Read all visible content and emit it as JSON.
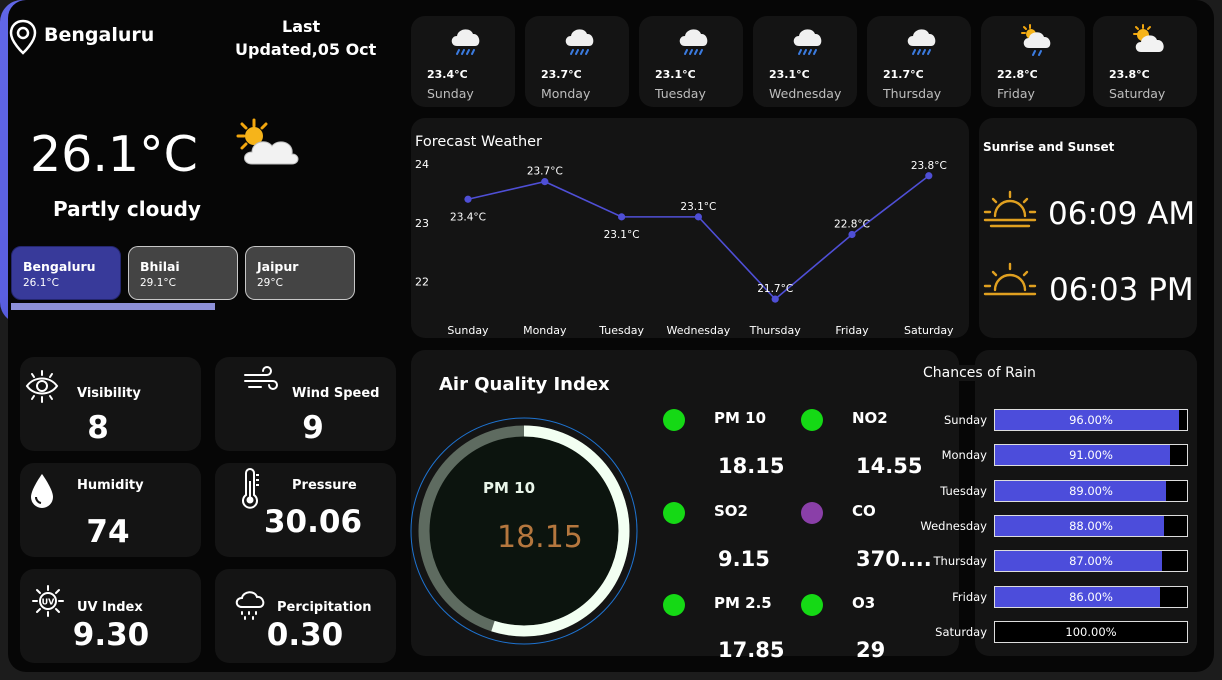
{
  "location": {
    "city": "Bengaluru",
    "last_updated_line1": "Last",
    "last_updated_line2": "Updated,05 Oct",
    "temperature": "26.1°C",
    "condition": "Partly cloudy",
    "icon": "partly-cloudy-icon",
    "cities": [
      {
        "name": "Bengaluru",
        "temp": "26.1°C"
      },
      {
        "name": "Bhilai",
        "temp": "29.1°C"
      },
      {
        "name": "Jaipur",
        "temp": "29°C"
      }
    ]
  },
  "week": [
    {
      "day": "Sunday",
      "temp": "23.4°C",
      "icon": "rain-cloud-icon"
    },
    {
      "day": "Monday",
      "temp": "23.7°C",
      "icon": "rain-cloud-icon"
    },
    {
      "day": "Tuesday",
      "temp": "23.1°C",
      "icon": "rain-cloud-icon"
    },
    {
      "day": "Wednesday",
      "temp": "23.1°C",
      "icon": "rain-cloud-icon"
    },
    {
      "day": "Thursday",
      "temp": "21.7°C",
      "icon": "rain-cloud-icon"
    },
    {
      "day": "Friday",
      "temp": "22.8°C",
      "icon": "sun-rain-cloud-icon"
    },
    {
      "day": "Saturday",
      "temp": "23.8°C",
      "icon": "partly-cloudy-icon"
    }
  ],
  "forecast": {
    "title": "Forecast Weather",
    "y_ticks": [
      "24",
      "23",
      "22"
    ]
  },
  "chart_data": {
    "type": "line",
    "title": "Forecast Weather",
    "categories": [
      "Sunday",
      "Monday",
      "Tuesday",
      "Wednesday",
      "Thursday",
      "Friday",
      "Saturday"
    ],
    "values": [
      23.4,
      23.7,
      23.1,
      23.1,
      21.7,
      22.8,
      23.8
    ],
    "labels": [
      "23.4°C",
      "23.7°C",
      "23.1°C",
      "23.1°C",
      "21.7°C",
      "22.8°C",
      "23.8°C"
    ],
    "ylim": [
      21.6,
      24
    ],
    "y_ticks": [
      22,
      23,
      24
    ],
    "line_color": "#4f4fd6",
    "grid": false
  },
  "sun": {
    "title": "Sunrise and Sunset",
    "sunrise": "06:09 AM",
    "sunset": "06:03 PM",
    "icon_color": "#e0a020"
  },
  "metrics": {
    "visibility": {
      "label": "Visibility",
      "value": "8",
      "icon": "eye-icon"
    },
    "wind": {
      "label": "Wind Speed",
      "value": "9",
      "icon": "wind-icon"
    },
    "humidity": {
      "label": "Humidity",
      "value": "74",
      "icon": "water-drop-icon"
    },
    "pressure": {
      "label": "Pressure",
      "value": "30.06",
      "icon": "thermometer-icon"
    },
    "uv": {
      "label": "UV Index",
      "value": "9.30",
      "icon": "uv-sun-icon"
    },
    "precip": {
      "label": "Percipitation",
      "value": "0.30",
      "icon": "rain-cloud-icon"
    }
  },
  "aqi": {
    "title": "Air Quality Index",
    "gauge_label": "PM 10",
    "gauge_value": "18.15",
    "gauge_fraction": 0.55,
    "items": [
      {
        "name": "PM 10",
        "value": "18.15",
        "color": "#15d915"
      },
      {
        "name": "NO2",
        "value": "14.55",
        "color": "#15d915"
      },
      {
        "name": "SO2",
        "value": "9.15",
        "color": "#15d915"
      },
      {
        "name": "CO",
        "value": "370....",
        "color": "#8a3fa8"
      },
      {
        "name": "PM 2.5",
        "value": "17.85",
        "color": "#15d915"
      },
      {
        "name": "O3",
        "value": "29",
        "color": "#15d915"
      }
    ]
  },
  "rain": {
    "title": "Chances of Rain",
    "rows": [
      {
        "day": "Sunday",
        "label": "96.00%",
        "value": 96
      },
      {
        "day": "Monday",
        "label": "91.00%",
        "value": 91
      },
      {
        "day": "Tuesday",
        "label": "89.00%",
        "value": 89
      },
      {
        "day": "Wednesday",
        "label": "88.00%",
        "value": 88
      },
      {
        "day": "Thursday",
        "label": "87.00%",
        "value": 87
      },
      {
        "day": "Friday",
        "label": "86.00%",
        "value": 86
      },
      {
        "day": "Saturday",
        "label": "100.00%",
        "value": 100
      }
    ],
    "bar_color": "#4c4ddb"
  }
}
